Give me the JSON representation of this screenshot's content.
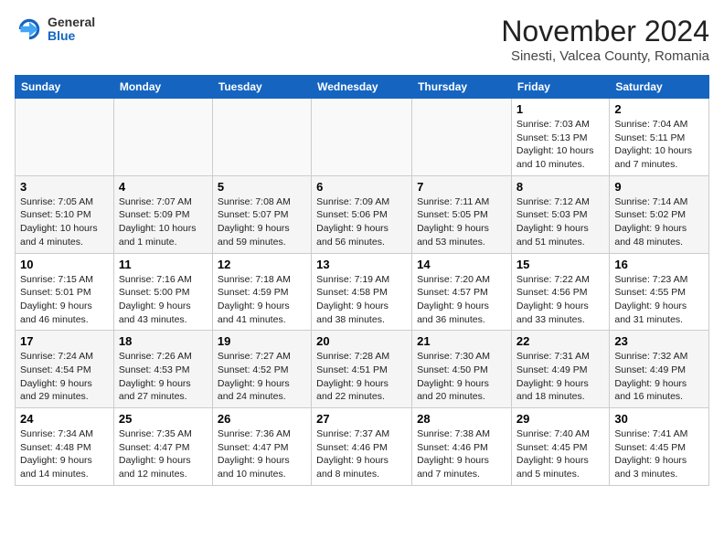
{
  "header": {
    "logo": {
      "general": "General",
      "blue": "Blue"
    },
    "title": "November 2024",
    "subtitle": "Sinesti, Valcea County, Romania"
  },
  "calendar": {
    "weekdays": [
      "Sunday",
      "Monday",
      "Tuesday",
      "Wednesday",
      "Thursday",
      "Friday",
      "Saturday"
    ],
    "weeks": [
      [
        {
          "day": "",
          "info": ""
        },
        {
          "day": "",
          "info": ""
        },
        {
          "day": "",
          "info": ""
        },
        {
          "day": "",
          "info": ""
        },
        {
          "day": "",
          "info": ""
        },
        {
          "day": "1",
          "info": "Sunrise: 7:03 AM\nSunset: 5:13 PM\nDaylight: 10 hours and 10 minutes."
        },
        {
          "day": "2",
          "info": "Sunrise: 7:04 AM\nSunset: 5:11 PM\nDaylight: 10 hours and 7 minutes."
        }
      ],
      [
        {
          "day": "3",
          "info": "Sunrise: 7:05 AM\nSunset: 5:10 PM\nDaylight: 10 hours and 4 minutes."
        },
        {
          "day": "4",
          "info": "Sunrise: 7:07 AM\nSunset: 5:09 PM\nDaylight: 10 hours and 1 minute."
        },
        {
          "day": "5",
          "info": "Sunrise: 7:08 AM\nSunset: 5:07 PM\nDaylight: 9 hours and 59 minutes."
        },
        {
          "day": "6",
          "info": "Sunrise: 7:09 AM\nSunset: 5:06 PM\nDaylight: 9 hours and 56 minutes."
        },
        {
          "day": "7",
          "info": "Sunrise: 7:11 AM\nSunset: 5:05 PM\nDaylight: 9 hours and 53 minutes."
        },
        {
          "day": "8",
          "info": "Sunrise: 7:12 AM\nSunset: 5:03 PM\nDaylight: 9 hours and 51 minutes."
        },
        {
          "day": "9",
          "info": "Sunrise: 7:14 AM\nSunset: 5:02 PM\nDaylight: 9 hours and 48 minutes."
        }
      ],
      [
        {
          "day": "10",
          "info": "Sunrise: 7:15 AM\nSunset: 5:01 PM\nDaylight: 9 hours and 46 minutes."
        },
        {
          "day": "11",
          "info": "Sunrise: 7:16 AM\nSunset: 5:00 PM\nDaylight: 9 hours and 43 minutes."
        },
        {
          "day": "12",
          "info": "Sunrise: 7:18 AM\nSunset: 4:59 PM\nDaylight: 9 hours and 41 minutes."
        },
        {
          "day": "13",
          "info": "Sunrise: 7:19 AM\nSunset: 4:58 PM\nDaylight: 9 hours and 38 minutes."
        },
        {
          "day": "14",
          "info": "Sunrise: 7:20 AM\nSunset: 4:57 PM\nDaylight: 9 hours and 36 minutes."
        },
        {
          "day": "15",
          "info": "Sunrise: 7:22 AM\nSunset: 4:56 PM\nDaylight: 9 hours and 33 minutes."
        },
        {
          "day": "16",
          "info": "Sunrise: 7:23 AM\nSunset: 4:55 PM\nDaylight: 9 hours and 31 minutes."
        }
      ],
      [
        {
          "day": "17",
          "info": "Sunrise: 7:24 AM\nSunset: 4:54 PM\nDaylight: 9 hours and 29 minutes."
        },
        {
          "day": "18",
          "info": "Sunrise: 7:26 AM\nSunset: 4:53 PM\nDaylight: 9 hours and 27 minutes."
        },
        {
          "day": "19",
          "info": "Sunrise: 7:27 AM\nSunset: 4:52 PM\nDaylight: 9 hours and 24 minutes."
        },
        {
          "day": "20",
          "info": "Sunrise: 7:28 AM\nSunset: 4:51 PM\nDaylight: 9 hours and 22 minutes."
        },
        {
          "day": "21",
          "info": "Sunrise: 7:30 AM\nSunset: 4:50 PM\nDaylight: 9 hours and 20 minutes."
        },
        {
          "day": "22",
          "info": "Sunrise: 7:31 AM\nSunset: 4:49 PM\nDaylight: 9 hours and 18 minutes."
        },
        {
          "day": "23",
          "info": "Sunrise: 7:32 AM\nSunset: 4:49 PM\nDaylight: 9 hours and 16 minutes."
        }
      ],
      [
        {
          "day": "24",
          "info": "Sunrise: 7:34 AM\nSunset: 4:48 PM\nDaylight: 9 hours and 14 minutes."
        },
        {
          "day": "25",
          "info": "Sunrise: 7:35 AM\nSunset: 4:47 PM\nDaylight: 9 hours and 12 minutes."
        },
        {
          "day": "26",
          "info": "Sunrise: 7:36 AM\nSunset: 4:47 PM\nDaylight: 9 hours and 10 minutes."
        },
        {
          "day": "27",
          "info": "Sunrise: 7:37 AM\nSunset: 4:46 PM\nDaylight: 9 hours and 8 minutes."
        },
        {
          "day": "28",
          "info": "Sunrise: 7:38 AM\nSunset: 4:46 PM\nDaylight: 9 hours and 7 minutes."
        },
        {
          "day": "29",
          "info": "Sunrise: 7:40 AM\nSunset: 4:45 PM\nDaylight: 9 hours and 5 minutes."
        },
        {
          "day": "30",
          "info": "Sunrise: 7:41 AM\nSunset: 4:45 PM\nDaylight: 9 hours and 3 minutes."
        }
      ]
    ]
  }
}
